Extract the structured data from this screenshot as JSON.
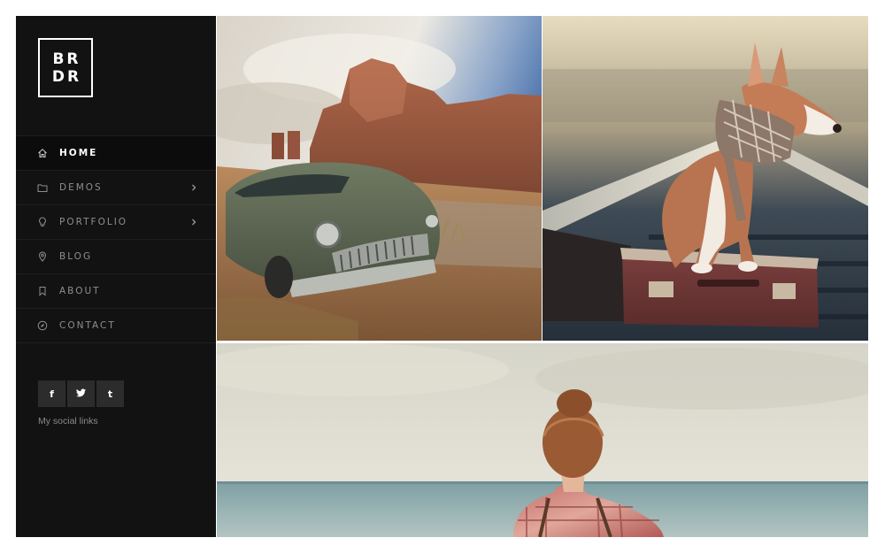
{
  "brand": {
    "logo_line1": "BR",
    "logo_line2": "DR"
  },
  "nav": {
    "items": [
      {
        "label": "HOME",
        "icon": "home-icon",
        "active": true,
        "has_submenu": false
      },
      {
        "label": "DEMOS",
        "icon": "folder-icon",
        "active": false,
        "has_submenu": true
      },
      {
        "label": "PORTFOLIO",
        "icon": "lightbulb-icon",
        "active": false,
        "has_submenu": true
      },
      {
        "label": "BLOG",
        "icon": "pin-icon",
        "active": false,
        "has_submenu": false
      },
      {
        "label": "ABOUT",
        "icon": "bookmark-icon",
        "active": false,
        "has_submenu": false
      },
      {
        "label": "CONTACT",
        "icon": "compass-icon",
        "active": false,
        "has_submenu": false
      }
    ]
  },
  "social": {
    "buttons": [
      {
        "glyph": "f",
        "icon": "facebook-icon"
      },
      {
        "glyph": "t",
        "icon": "twitter-icon"
      },
      {
        "glyph": "t",
        "icon": "tumblr-icon"
      }
    ],
    "label": "My social links"
  },
  "gallery": {
    "tiles": [
      {
        "subject": "vintage car in desert canyon"
      },
      {
        "subject": "dog with scarf sitting on suitcase on railway tracks"
      },
      {
        "subject": "woman looking at the sea"
      }
    ]
  },
  "colors": {
    "sidebar_bg": "#121212",
    "accent": "#ffffff",
    "muted_text": "#8e8e8e"
  }
}
